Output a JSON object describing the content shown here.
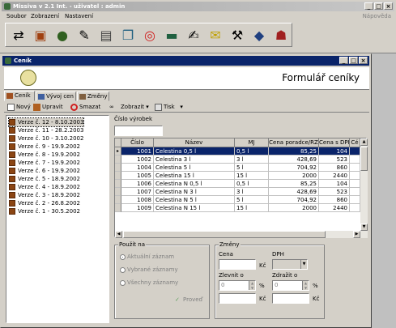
{
  "app": {
    "title": "Missiva v 2.1 Int. - uživatel : admin",
    "menu": [
      "Soubor",
      "Zobrazení",
      "Nastavení"
    ],
    "help": "Nápověda",
    "toolbar_icons": [
      "transfer-icon",
      "bag-icon",
      "money-bag-icon",
      "tools-icon",
      "forms-icon",
      "documents-icon",
      "lifebuoy-icon",
      "book-icon",
      "writing-icon",
      "notes-icon",
      "hammer-icon",
      "package-icon",
      "people-icon"
    ]
  },
  "window": {
    "title": "Ceník",
    "header_title": "Formulář ceníky",
    "tabs": [
      "Ceník",
      "Vývoj cen",
      "Změny"
    ],
    "commands": {
      "new": "Nový",
      "edit": "Upravit",
      "delete": "Smazat",
      "view": "Zobrazit",
      "print": "Tisk"
    }
  },
  "versions": [
    "Verze č. 12 - 8.10.2003",
    "Verze č. 11 - 28.2.2003",
    "Verze č. 10 - 3.10.2002",
    "Verze č. 9 - 19.9.2002",
    "Verze č. 8 - 19.9.2002",
    "Verze č. 7 - 19.9.2002",
    "Verze č. 6 - 19.9.2002",
    "Verze č. 5 - 18.9.2002",
    "Verze č. 4 - 18.9.2002",
    "Verze č. 3 - 18.9.2002",
    "Verze č. 2 - 26.8.2002",
    "Verze č. 1 - 30.5.2002"
  ],
  "search": {
    "label": "Číslo výrobek",
    "value": ""
  },
  "grid": {
    "columns": [
      "Číslo",
      "Název",
      "MJ",
      "Cena poradce/RZ",
      "Cena s DPH",
      "Cé"
    ],
    "rows": [
      [
        "1001",
        "Celestina 0,5 l",
        "0,5 l",
        "85,25",
        "104"
      ],
      [
        "1002",
        "Celestina 3 l",
        "3 l",
        "428,69",
        "523"
      ],
      [
        "1004",
        "Celestina 5 l",
        "5 l",
        "704,92",
        "860"
      ],
      [
        "1005",
        "Celestina 15 l",
        "15 l",
        "2000",
        "2440"
      ],
      [
        "1006",
        "Celestina N 0,5 l",
        "0,5 l",
        "85,25",
        "104"
      ],
      [
        "1007",
        "Celestina N 3 l",
        "3 l",
        "428,69",
        "523"
      ],
      [
        "1008",
        "Celestina N 5 l",
        "5 l",
        "704,92",
        "860"
      ],
      [
        "1009",
        "Celestina N 15 l",
        "15 l",
        "2000",
        "2440"
      ]
    ]
  },
  "pouzit": {
    "label": "Použít na",
    "options": [
      "Aktuální záznam",
      "Vybrané záznamy",
      "Všechny záznamy"
    ],
    "apply": "Proveď"
  },
  "zmeny": {
    "label": "Změny",
    "cena": "Cena",
    "dph": "DPH",
    "zlevnit": "Zlevnit o",
    "zdrazit": "Zdražit o",
    "kc": "Kč",
    "pct": "%",
    "zero": "0"
  }
}
